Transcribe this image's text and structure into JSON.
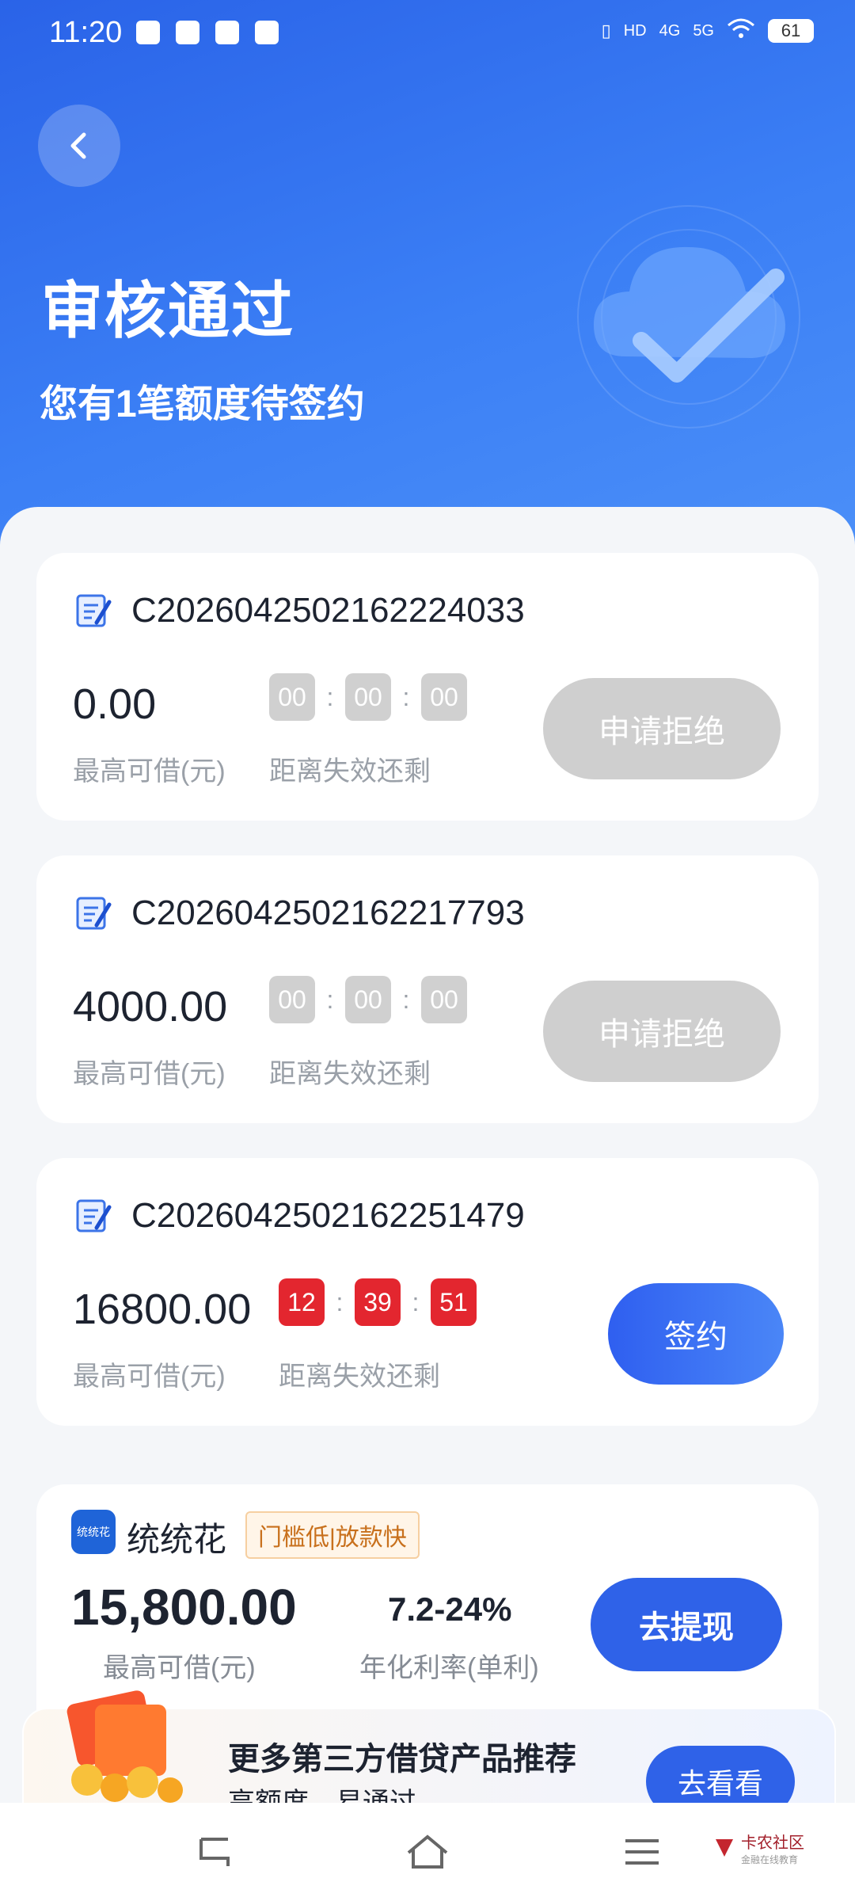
{
  "status_bar": {
    "time": "11:20",
    "hd": "HD",
    "net1": "4G",
    "net2": "5G",
    "battery": "61"
  },
  "header": {
    "title": "审核通过",
    "subtitle": "您有1笔额度待签约"
  },
  "contracts": [
    {
      "contract_no": "C2026042502162224033",
      "amount": "0.00",
      "amount_label": "最高可借(元)",
      "timer": [
        "00",
        "00",
        "00"
      ],
      "timer_label": "距离失效还剩",
      "button_label": "申请拒绝",
      "active": false
    },
    {
      "contract_no": "C2026042502162217793",
      "amount": "4000.00",
      "amount_label": "最高可借(元)",
      "timer": [
        "00",
        "00",
        "00"
      ],
      "timer_label": "距离失效还剩",
      "button_label": "申请拒绝",
      "active": false
    },
    {
      "contract_no": "C2026042502162251479",
      "amount": "16800.00",
      "amount_label": "最高可借(元)",
      "timer": [
        "12",
        "39",
        "51"
      ],
      "timer_label": "距离失效还剩",
      "button_label": "签约",
      "active": true
    }
  ],
  "product": {
    "logo_text": "统统花",
    "name": "统统花",
    "tag": "门槛低|放款快",
    "amount": "15,800.00",
    "amount_label": "最高可借(元)",
    "rate": "7.2-24%",
    "rate_label": "年化利率(单利)",
    "button_label": "去提现"
  },
  "banner": {
    "title": "更多第三方借贷产品推荐",
    "subtitle": "高额度，易通过",
    "button_label": "去看看"
  },
  "watermark": {
    "name": "卡农社区",
    "sub": "金融在线教育"
  },
  "colors": {
    "brand_blue": "#2f62e8",
    "timer_red": "#e3262f",
    "disabled_gray": "#cfcfcf"
  }
}
